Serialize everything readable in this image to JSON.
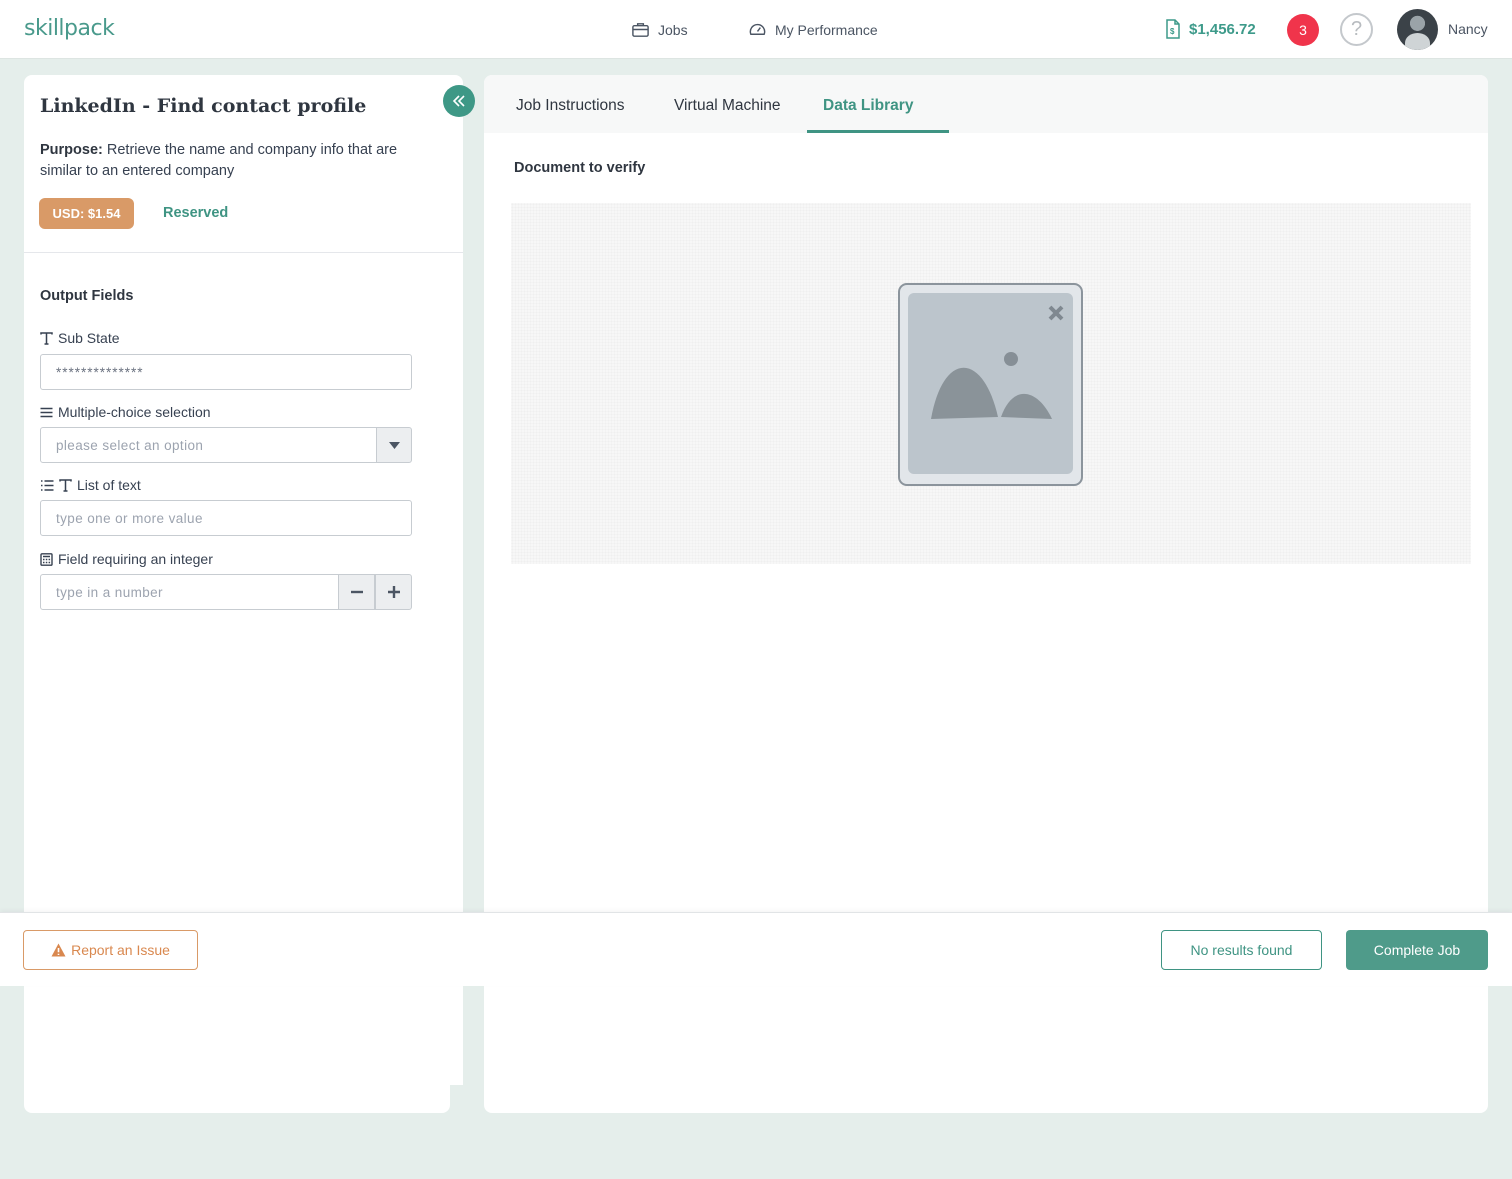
{
  "header": {
    "logo": "skillpack",
    "nav": [
      {
        "label": "Jobs",
        "icon": "briefcase-icon"
      },
      {
        "label": "My Performance",
        "icon": "speedometer-icon"
      }
    ],
    "balance": "$1,456.72",
    "notifications": "3",
    "help": "?",
    "user": "Nancy"
  },
  "job": {
    "title": "LinkedIn - Find contact profile",
    "purpose_label": "Purpose:",
    "purpose_text": "Retrieve the name and company info that are similar to an entered company",
    "price": "USD: $1.54",
    "status": "Reserved"
  },
  "output": {
    "title": "Output Fields",
    "fields": [
      {
        "label": "Sub State",
        "value": "**************",
        "icon": "text-icon"
      },
      {
        "label": "Multiple-choice selection",
        "placeholder": "please select an option",
        "icon": "list-icon"
      },
      {
        "label": "List of text",
        "placeholder": "type one or more value",
        "icon": "list-text-icon"
      },
      {
        "label": "Field requiring an integer",
        "placeholder": "type in a number",
        "icon": "calculator-icon"
      }
    ]
  },
  "tabs": [
    {
      "label": "Job Instructions"
    },
    {
      "label": "Virtual Machine"
    },
    {
      "label": "Data Library"
    }
  ],
  "active_tab": "Data Library",
  "document": {
    "title": "Document to verify"
  },
  "footer": {
    "report": "Report an Issue",
    "no_results": "No results found",
    "complete": "Complete Job"
  },
  "colors": {
    "accent": "#3f9483",
    "price": "#d99a67",
    "notification": "#f0344b",
    "warning": "#d9884f"
  }
}
